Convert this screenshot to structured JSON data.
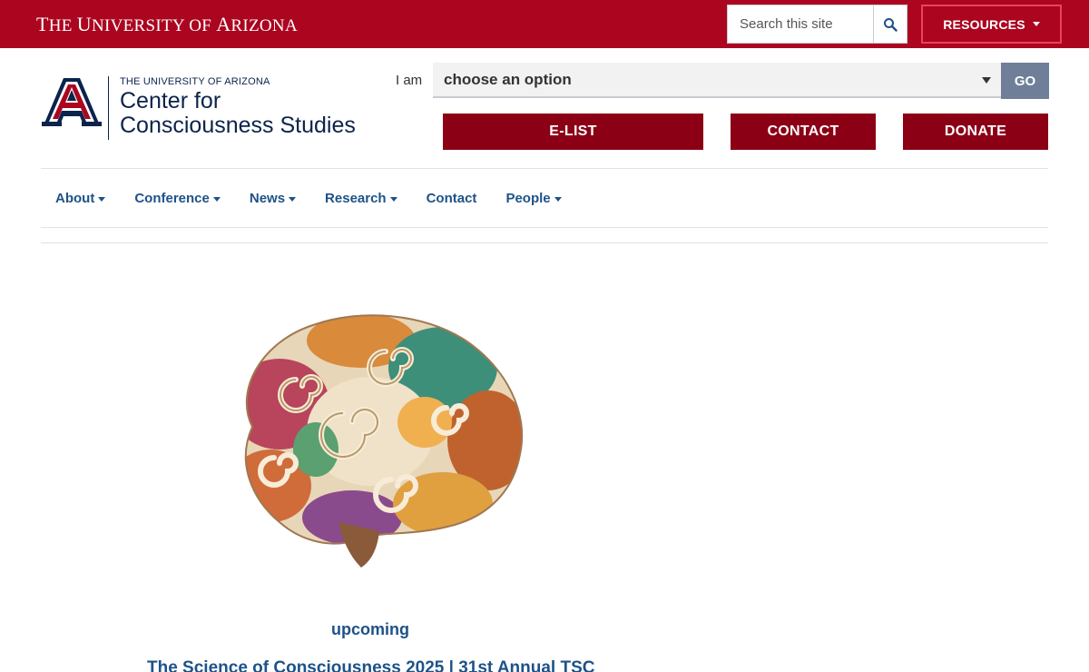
{
  "topbar": {
    "wordmark_first": "T",
    "wordmark_rest1": "HE ",
    "wordmark_u": "U",
    "wordmark_rest2": "NIVERSITY OF ",
    "wordmark_a": "A",
    "wordmark_rest3": "RIZONA",
    "search_placeholder": "Search this site",
    "resources_label": "RESOURCES"
  },
  "logo": {
    "small_text": "THE UNIVERSITY OF ARIZONA",
    "title_line1": "Center for",
    "title_line2": "Consciousness Studies"
  },
  "selector": {
    "label": "I am",
    "value": "choose an option",
    "go_label": "GO"
  },
  "actions": {
    "elist": "E-LIST",
    "contact": "CONTACT",
    "donate": "DONATE"
  },
  "nav": [
    {
      "label": "About",
      "dropdown": true
    },
    {
      "label": "Conference",
      "dropdown": true
    },
    {
      "label": "News",
      "dropdown": true
    },
    {
      "label": "Research",
      "dropdown": true
    },
    {
      "label": "Contact",
      "dropdown": false
    },
    {
      "label": "People",
      "dropdown": true
    }
  ],
  "hero": {
    "image": "colorful-mosaic-brain",
    "upcoming": "upcoming",
    "event_title": "The Science of Consciousness 2025 | 31st Annual TSC"
  },
  "colors": {
    "brand_red": "#ab0520",
    "button_red": "#8b0015",
    "navy": "#0c234b",
    "link_blue": "#1e5288"
  }
}
